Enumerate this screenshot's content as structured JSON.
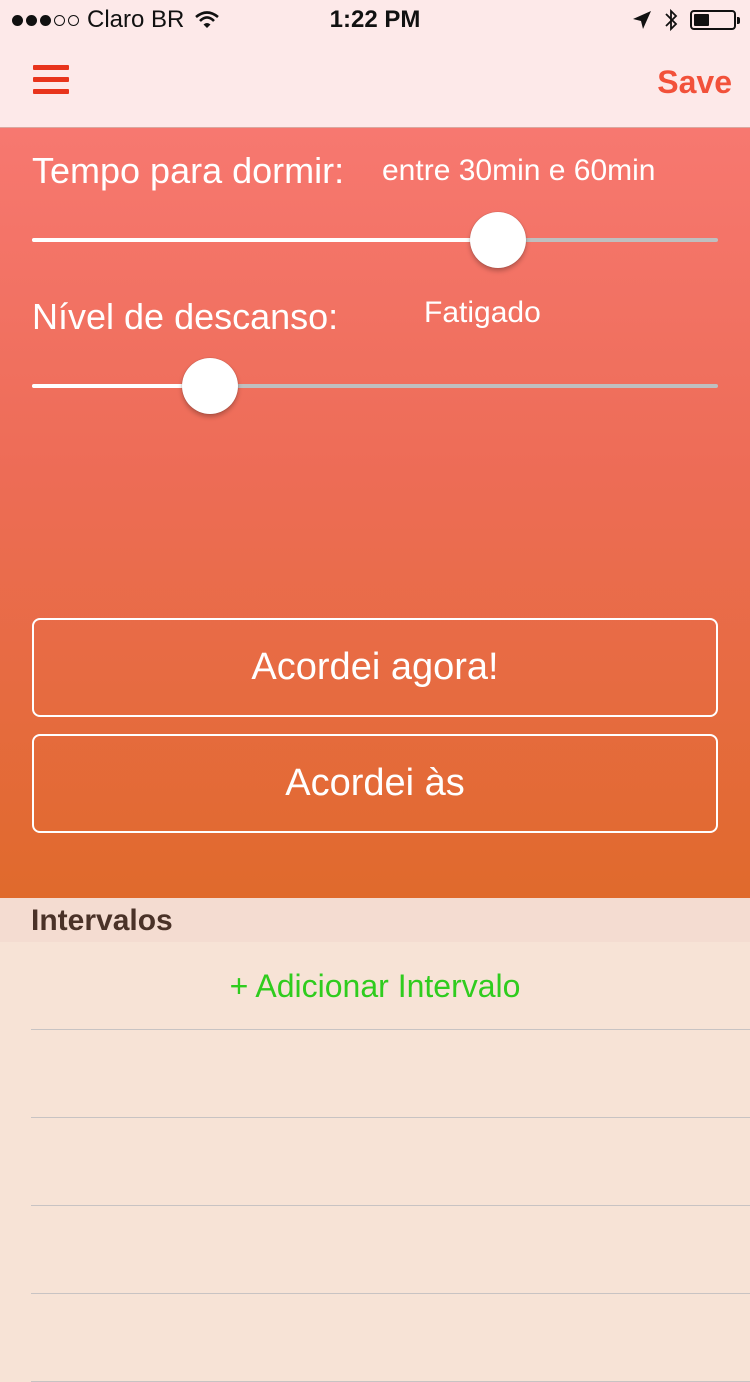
{
  "status_bar": {
    "carrier": "Claro BR",
    "time": "1:22 PM",
    "battery_level": 0.45,
    "signal_bars": 3
  },
  "nav": {
    "menu_icon": "hamburger-menu-icon",
    "save_label": "Save",
    "accent_color": "#e8341c"
  },
  "sleep": {
    "time_label": "Tempo para dormir:",
    "time_value": "entre 30min e 60min",
    "time_slider": 0.68,
    "rest_label": "Nível de descanso:",
    "rest_value": "Fatigado",
    "rest_slider": 0.26
  },
  "actions": {
    "wake_now": "Acordei agora!",
    "wake_at": "Acordei às"
  },
  "intervals": {
    "header": "Intervalos",
    "add_label": "+ Adicionar Intervalo",
    "add_color": "#2fcc1e"
  }
}
